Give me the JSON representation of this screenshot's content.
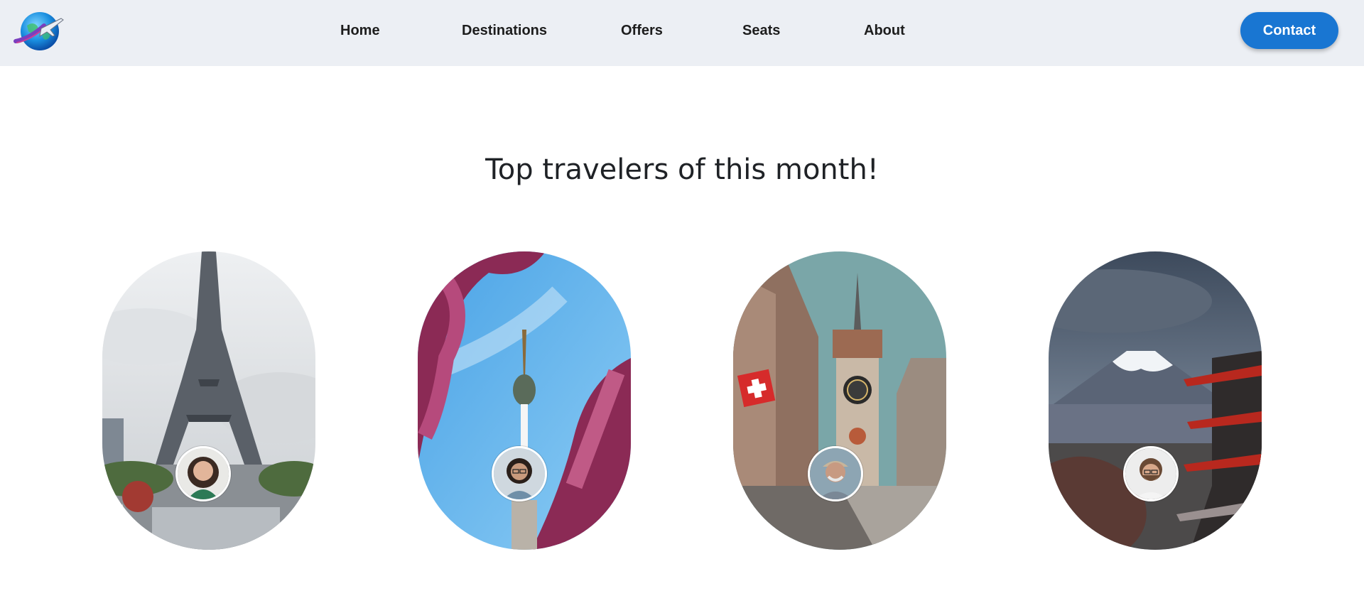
{
  "nav": {
    "logo_icon": "globe-airplane-icon",
    "links": [
      "Home",
      "Destinations",
      "Offers",
      "Seats",
      "About"
    ],
    "contact_label": "Contact",
    "accent": "#1976d2",
    "background": "#eceff4"
  },
  "main": {
    "heading": "Top travelers of this month!",
    "travelers": [
      {
        "scene": "eiffel-tower-photo",
        "avatar": "smiling-woman-avatar"
      },
      {
        "scene": "seoul-tower-photo",
        "avatar": "woman-glasses-avatar"
      },
      {
        "scene": "bern-clock-tower-photo",
        "avatar": "older-man-cap-avatar"
      },
      {
        "scene": "mount-fuji-pagoda-photo",
        "avatar": "bearded-man-glasses-avatar"
      }
    ]
  }
}
